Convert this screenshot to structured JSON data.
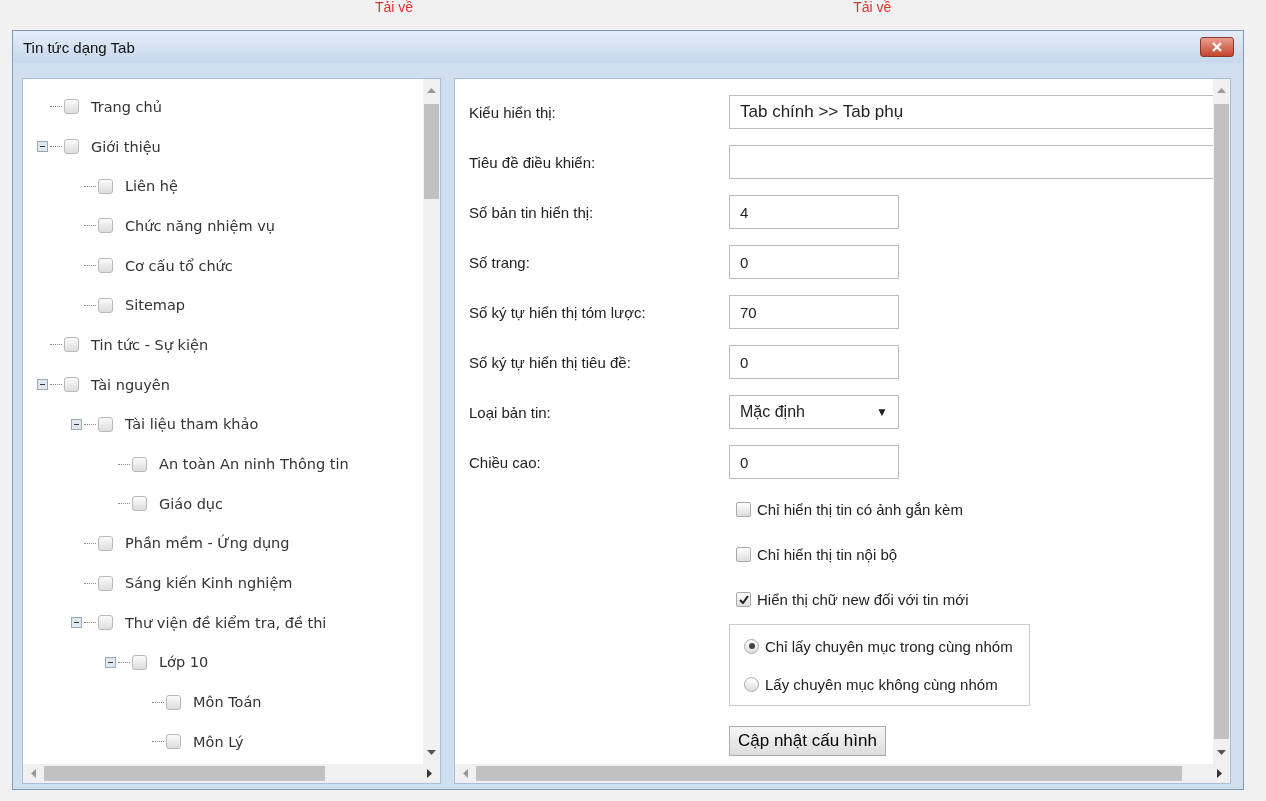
{
  "background": {
    "links": [
      "Tải về",
      "Tải về"
    ]
  },
  "window": {
    "title": "Tin tức dạng Tab"
  },
  "tree": [
    {
      "label": "Trang chủ",
      "checked": false
    },
    {
      "label": "Giới thiệu",
      "checked": false,
      "expanded": true,
      "children": [
        {
          "label": "Liên hệ",
          "checked": false
        },
        {
          "label": "Chức năng nhiệm vụ",
          "checked": false
        },
        {
          "label": "Cơ cấu tổ chức",
          "checked": false
        },
        {
          "label": "Sitemap",
          "checked": false
        }
      ]
    },
    {
      "label": "Tin tức - Sự kiện",
      "checked": false
    },
    {
      "label": "Tài nguyên",
      "checked": false,
      "expanded": true,
      "children": [
        {
          "label": "Tài liệu tham khảo",
          "checked": false,
          "expanded": true,
          "children": [
            {
              "label": "An toàn An ninh Thông tin",
              "checked": false
            },
            {
              "label": "Giáo dục",
              "checked": false
            }
          ]
        },
        {
          "label": "Phần mềm - Ứng dụng",
          "checked": false
        },
        {
          "label": "Sáng kiến Kinh nghiệm",
          "checked": false
        },
        {
          "label": "Thư viện đề kiểm tra, đề thi",
          "checked": false,
          "expanded": true,
          "children": [
            {
              "label": "Lớp 10",
              "checked": false,
              "expanded": true,
              "children": [
                {
                  "label": "Môn Toán",
                  "checked": false
                },
                {
                  "label": "Môn Lý",
                  "checked": false
                }
              ]
            }
          ]
        }
      ]
    }
  ],
  "form": {
    "fields": [
      {
        "label": "Kiểu hiển thị:",
        "kind": "wide",
        "value": "Tab chính >> Tab phụ"
      },
      {
        "label": "Tiêu đề điều khiển:",
        "kind": "wide"
      },
      {
        "label": "Số bản tin hiển thị:",
        "kind": "text",
        "value": "4"
      },
      {
        "label": "Số trang:",
        "kind": "text",
        "value": "0"
      },
      {
        "label": "Số ký tự hiển thị tóm lược:",
        "kind": "text",
        "value": "70"
      },
      {
        "label": "Số ký tự hiển thị tiêu đề:",
        "kind": "text",
        "value": "0"
      },
      {
        "label": "Loại bản tin:",
        "kind": "select",
        "value": "Mặc định",
        "arrow": "▼"
      },
      {
        "label": "Chiều cao:",
        "kind": "text",
        "value": "0"
      }
    ],
    "checkboxes": [
      {
        "label": "Chỉ hiển thị tin có ảnh gắn kèm",
        "checked": false
      },
      {
        "label": "Chỉ hiển thị tin nội bộ",
        "checked": false
      },
      {
        "label": "Hiển thị chữ new đối với tin mới",
        "checked": true
      }
    ],
    "radios": [
      {
        "label": "Chỉ lấy chuyên mục trong cùng nhóm",
        "selected": true
      },
      {
        "label": "Lấy chuyên mục không cùng nhóm",
        "selected": false
      }
    ],
    "button": "Cập nhật cấu hình"
  }
}
